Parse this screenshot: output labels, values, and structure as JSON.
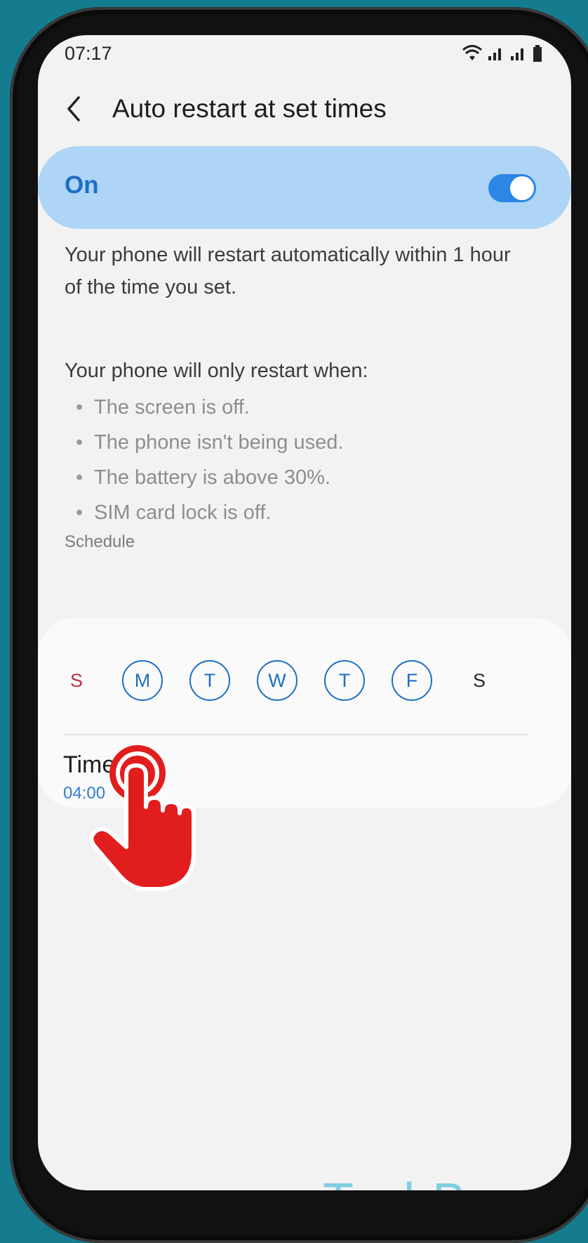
{
  "status_bar": {
    "time": "07:17"
  },
  "header": {
    "title": "Auto restart at set times"
  },
  "toggle": {
    "label": "On",
    "state": "on"
  },
  "description": {
    "para1": "Your phone will restart automatically within 1 hour of the time you set.",
    "para2": "Your phone will only restart when:",
    "conditions": [
      "The screen is off.",
      "The phone isn't being used.",
      "The battery is above 30%.",
      "SIM card lock is off."
    ]
  },
  "schedule": {
    "section_label": "Schedule",
    "days": [
      {
        "label": "S",
        "selected": false
      },
      {
        "label": "M",
        "selected": true
      },
      {
        "label": "T",
        "selected": true
      },
      {
        "label": "W",
        "selected": true
      },
      {
        "label": "T",
        "selected": true
      },
      {
        "label": "F",
        "selected": true
      },
      {
        "label": "S",
        "selected": false
      }
    ],
    "time_label": "Time",
    "time_value": "04:00"
  },
  "watermark": "TechBone",
  "colors": {
    "accent": "#2b86e6",
    "toggle_card": "#aed4f6",
    "sunday": "#b8324a",
    "hand": "#e21d1d"
  }
}
